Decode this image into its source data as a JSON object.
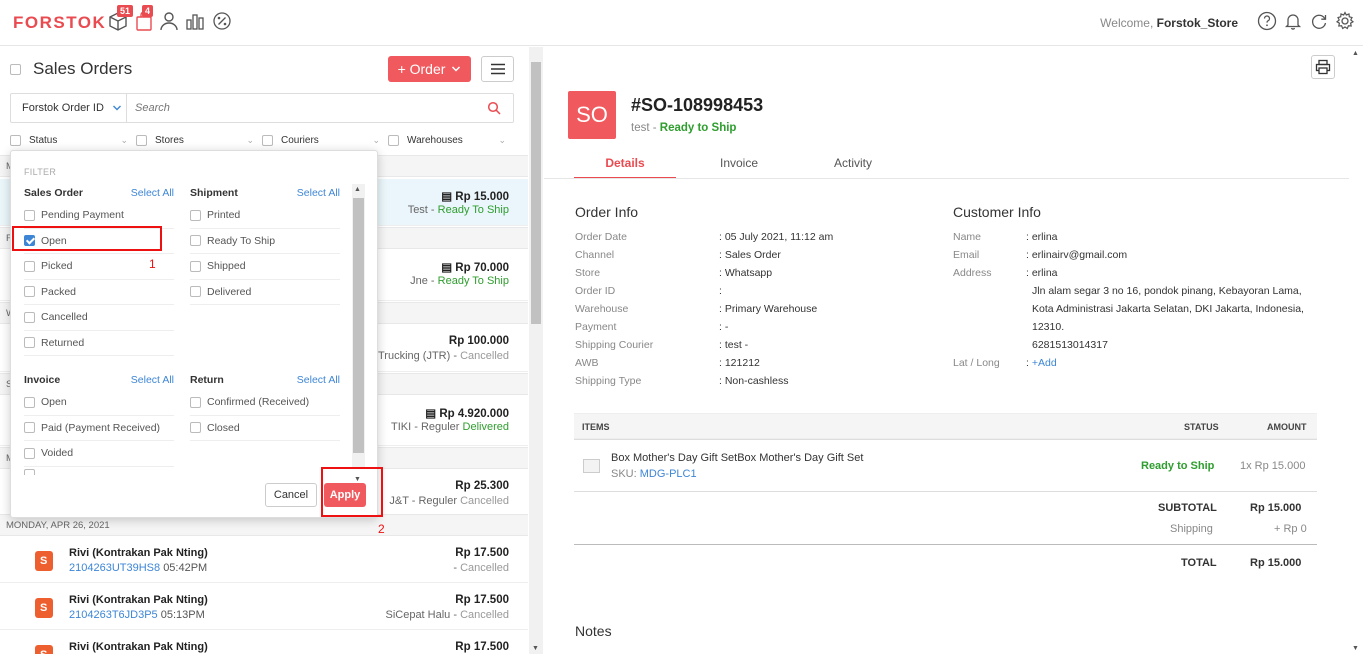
{
  "brand": "FORSTOK",
  "top": {
    "badge1": "51",
    "badge2": "4",
    "welcome_prefix": "Welcome,",
    "welcome_user": "Forstok_Store"
  },
  "left": {
    "title": "Sales Orders",
    "order_button": "+ Order",
    "search_field_select": "Forstok Order ID",
    "search_placeholder": "Search",
    "filters": [
      "Status",
      "Stores",
      "Couriers",
      "Warehouses"
    ],
    "groups": [
      {
        "label": "M"
      },
      {
        "label": "F"
      },
      {
        "label": "W"
      },
      {
        "label": "S"
      },
      {
        "label": "M"
      },
      {
        "label": "MONDAY, APR 26, 2021"
      }
    ],
    "rows": [
      {
        "amount": "Rp 15.000",
        "courier": "Test - ",
        "status": "Ready To Ship",
        "status_color": "green"
      },
      {
        "amount": "Rp 70.000",
        "courier": "Jne - ",
        "status": "Ready To Ship",
        "status_color": "green"
      },
      {
        "amount": "Rp 100.000",
        "courier": "E Trucking (JTR) - ",
        "status": "Cancelled",
        "status_color": "gray"
      },
      {
        "amount": "Rp 4.920.000",
        "courier": "TIKI - Reguler ",
        "status": "Delivered",
        "status_color": "green"
      },
      {
        "amount": "Rp 25.300",
        "courier": "J&T - Reguler ",
        "status": "Cancelled",
        "status_color": "gray"
      },
      {
        "customer": "Rivi (Kontrakan Pak Nting)",
        "order_id": "2104263UT39HS8",
        "time": "05:42PM",
        "amount": "Rp 17.500",
        "courier": "- ",
        "status": "Cancelled",
        "status_color": "gray"
      },
      {
        "customer": "Rivi (Kontrakan Pak Nting)",
        "order_id": "2104263T6JD3P5",
        "time": "05:13PM",
        "amount": "Rp 17.500",
        "courier": "SiCepat Halu - ",
        "status": "Cancelled",
        "status_color": "gray"
      },
      {
        "customer": "Rivi (Kontrakan Pak Nting)",
        "amount": "Rp 17.500"
      }
    ]
  },
  "popup": {
    "title": "FILTER",
    "select_all": "Select All",
    "sales_order": {
      "label": "Sales Order",
      "items": [
        "Pending Payment",
        "Open",
        "Picked",
        "Packed",
        "Cancelled",
        "Returned"
      ]
    },
    "shipment": {
      "label": "Shipment",
      "items": [
        "Printed",
        "Ready To Ship",
        "Shipped",
        "Delivered"
      ]
    },
    "invoice": {
      "label": "Invoice",
      "items": [
        "Open",
        "Paid (Payment Received)",
        "Voided"
      ]
    },
    "return": {
      "label": "Return",
      "items": [
        "Confirmed (Received)",
        "Closed"
      ]
    },
    "cancel": "Cancel",
    "apply": "Apply",
    "annotation_1": "1",
    "annotation_2": "2"
  },
  "detail": {
    "avatar": "SO",
    "number": "#SO-108998453",
    "courier_prefix": "test - ",
    "status": "Ready to Ship",
    "tabs": [
      "Details",
      "Invoice",
      "Activity"
    ],
    "order_info": {
      "title": "Order Info",
      "rows": [
        {
          "k": "Order Date",
          "v": ": 05 July 2021, 11:12 am"
        },
        {
          "k": "Channel",
          "v": ": Sales Order"
        },
        {
          "k": "Store",
          "v": ": Whatsapp"
        },
        {
          "k": "Order ID",
          "v": ":"
        },
        {
          "k": "Warehouse",
          "v": ": Primary Warehouse"
        },
        {
          "k": "Payment",
          "v": ": -"
        },
        {
          "k": "Shipping Courier",
          "v": ": test -"
        },
        {
          "k": "AWB",
          "v": ": 121212"
        },
        {
          "k": "Shipping Type",
          "v": ": Non-cashless"
        }
      ]
    },
    "customer_info": {
      "title": "Customer Info",
      "name_k": "Name",
      "name_v": ": erlina",
      "email_k": "Email",
      "email_v": ": erlinairv@gmail.com",
      "address_k": "Address",
      "address_lines": [
        ": erlina",
        "Jln alam segar 3 no 16, pondok pinang, Kebayoran Lama,",
        "Kota Administrasi Jakarta Selatan, DKI Jakarta, Indonesia,",
        "12310.",
        "6281513014317"
      ],
      "latlong_k": "Lat / Long",
      "latlong_v": "+Add"
    },
    "items": {
      "h_items": "ITEMS",
      "h_status": "STATUS",
      "h_amount": "AMOUNT",
      "name": "Box Mother's Day Gift SetBox Mother's Day Gift Set",
      "sku_label": "SKU:",
      "sku": "MDG-PLC1",
      "status": "Ready to Ship",
      "amount": "1x Rp 15.000"
    },
    "totals": {
      "subtotal_k": "SUBTOTAL",
      "subtotal_v": "Rp 15.000",
      "shipping_k": "Shipping",
      "shipping_v": "+ Rp 0",
      "total_k": "TOTAL",
      "total_v": "Rp 15.000"
    },
    "notes": "Notes"
  }
}
